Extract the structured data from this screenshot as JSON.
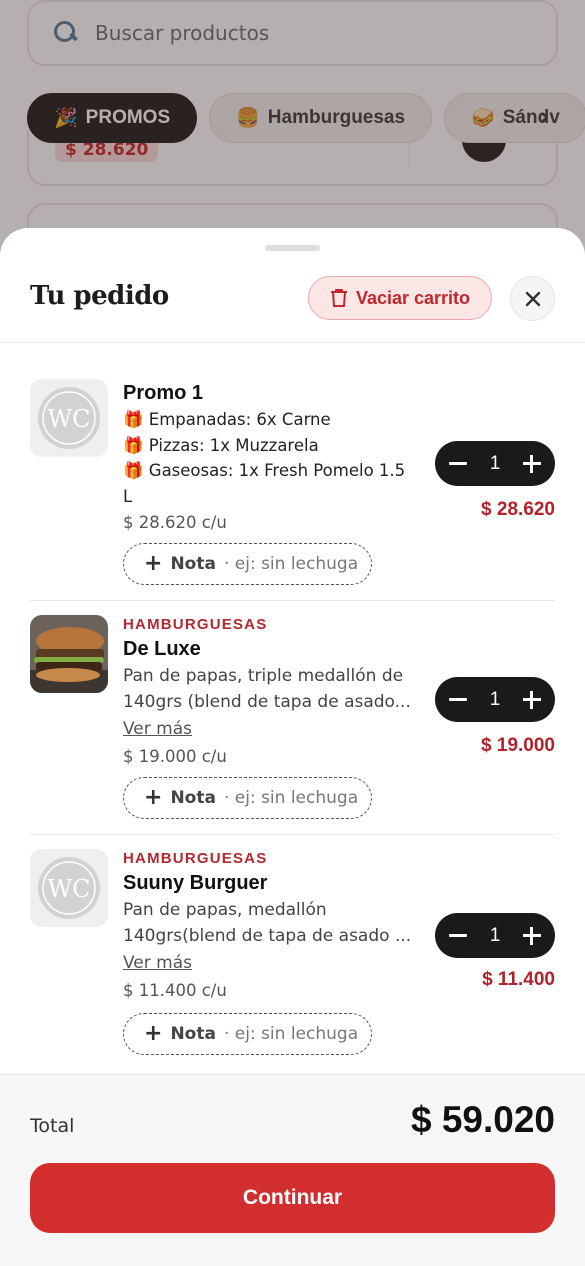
{
  "background": {
    "search": {
      "placeholder": "Buscar productos",
      "icon": "search-icon"
    },
    "categories": [
      {
        "emoji": "🎉",
        "label": "PROMOS",
        "active": true
      },
      {
        "emoji": "🍔",
        "label": "Hamburguesas",
        "active": false
      },
      {
        "emoji": "🥪",
        "label": "Sándv",
        "active": false
      }
    ],
    "partial_price": "$ 28.620"
  },
  "cart": {
    "title": "Tu pedido",
    "clear_label": "Vaciar carrito",
    "note_label": "Nota",
    "note_hint": "· ej: sin lechuga",
    "see_more": "Ver más",
    "items": [
      {
        "category": "",
        "name": "Promo 1",
        "lines": [
          "🎁 Empanadas: 6x Carne",
          "🎁 Pizzas: 1x Muzzarela",
          "🎁 Gaseosas: 1x Fresh Pomelo 1.5",
          "L"
        ],
        "unit_price": "$ 28.620 c/u",
        "quantity": "1",
        "subtotal": "$ 28.620",
        "image": "logo"
      },
      {
        "category": "HAMBURGUESAS",
        "name": "De Luxe",
        "desc1": "Pan de papas, triple medallón de",
        "desc2": "140grs (blend de tapa de asado...",
        "unit_price": "$ 19.000 c/u",
        "quantity": "1",
        "subtotal": "$ 19.000",
        "image": "burger-photo"
      },
      {
        "category": "HAMBURGUESAS",
        "name": "Suuny Burguer",
        "desc1": "Pan de papas, medallón",
        "desc2": "140grs(blend de tapa de asado ...",
        "unit_price": "$ 11.400 c/u",
        "quantity": "1",
        "subtotal": "$ 11.400",
        "image": "logo"
      }
    ],
    "total_label": "Total",
    "total_value": "$ 59.020",
    "continue_label": "Continuar"
  },
  "colors": {
    "accent": "#d32e2e",
    "price": "#b3222a",
    "dark": "#1a1a1a"
  }
}
